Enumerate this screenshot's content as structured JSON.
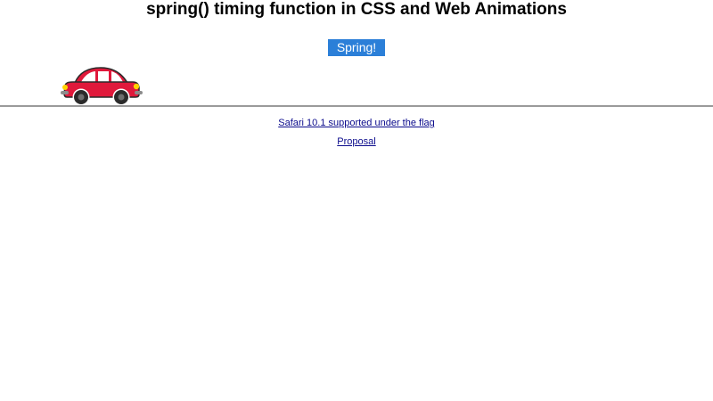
{
  "page": {
    "title": "spring() timing function in CSS and Web Animations"
  },
  "controls": {
    "spring_button_label": "Spring!"
  },
  "links": {
    "safari_label": "Safari 10.1 supported under the flag",
    "proposal_label": "Proposal"
  },
  "colors": {
    "button_bg": "#2b7fd8",
    "car_body": "#e0193b",
    "ground_line": "#9a9a9a",
    "link": "#0b0b8c"
  },
  "icons": {
    "car": "car-icon"
  }
}
